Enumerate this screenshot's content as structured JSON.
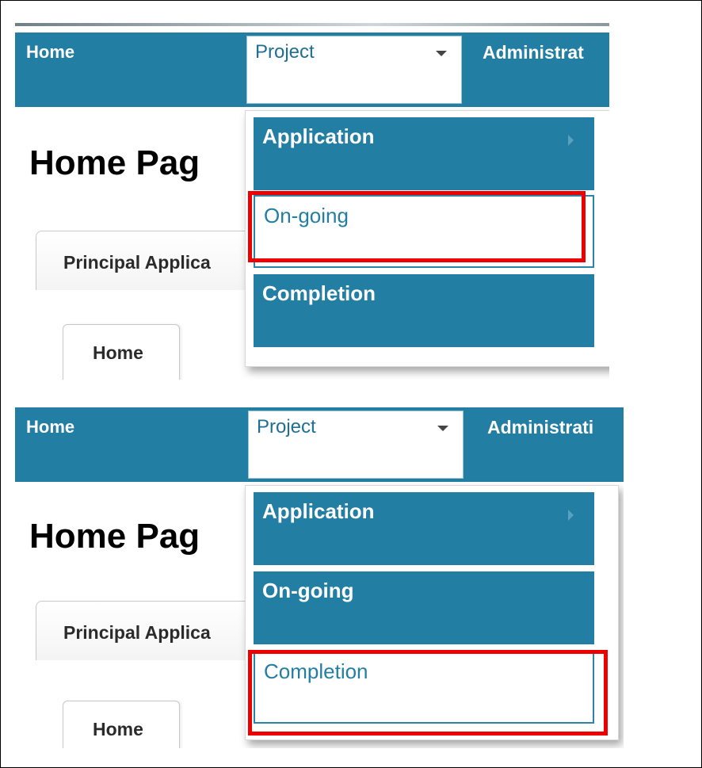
{
  "panels": [
    {
      "nav": {
        "home": "Home",
        "project": "Project",
        "admin": "Administrat"
      },
      "page_title": "Home Pag",
      "tabs": {
        "principal": "Principal Applica",
        "home": "Home"
      },
      "menu": [
        {
          "label": "Application",
          "state": "normal",
          "submenu": true
        },
        {
          "label": "On-going",
          "state": "hover",
          "submenu": false
        },
        {
          "label": "Completion",
          "state": "normal",
          "submenu": false
        }
      ],
      "highlighted_item": "On-going"
    },
    {
      "nav": {
        "home": "Home",
        "project": "Project",
        "admin": "Administrati"
      },
      "page_title": "Home Pag",
      "tabs": {
        "principal": "Principal Applica",
        "home": "Home"
      },
      "menu": [
        {
          "label": "Application",
          "state": "normal",
          "submenu": true
        },
        {
          "label": "On-going",
          "state": "normal",
          "submenu": false
        },
        {
          "label": "Completion",
          "state": "hover",
          "submenu": false
        }
      ],
      "highlighted_item": "Completion"
    }
  ],
  "colors": {
    "navbar": "#237ea3",
    "highlight": "#ee0000",
    "link_text": "#237ea3"
  },
  "icons": {
    "dropdown": "caret-down-icon",
    "submenu": "chevron-right-icon"
  }
}
